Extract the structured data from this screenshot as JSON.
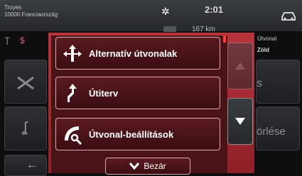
{
  "status": {
    "city": "Troyes",
    "address": "10000 Franciaország",
    "time": "2:01",
    "distance": "167 km",
    "route_side": "Útvonal",
    "route_color": "Zöld"
  },
  "background": {
    "partial_right_1": "s",
    "partial_right_2": "örlése"
  },
  "menu": {
    "items": [
      {
        "label": "Alternatív útvonalak",
        "icon": "alternative-routes-icon"
      },
      {
        "label": "Útiterv",
        "icon": "itinerary-icon"
      },
      {
        "label": "Útvonal-beállítások",
        "icon": "route-settings-icon"
      }
    ],
    "close_label": "Bezár"
  },
  "colors": {
    "accent": "#c8303a",
    "panel": "#4a1318"
  }
}
